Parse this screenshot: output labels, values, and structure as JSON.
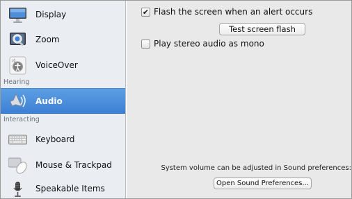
{
  "sidebar": {
    "items": [
      {
        "label": "Display",
        "icon": "display-icon"
      },
      {
        "label": "Zoom",
        "icon": "zoom-icon"
      },
      {
        "label": "VoiceOver",
        "icon": "voiceover-icon"
      },
      {
        "label": "Audio",
        "icon": "audio-icon",
        "selected": true
      },
      {
        "label": "Keyboard",
        "icon": "keyboard-icon"
      },
      {
        "label": "Mouse & Trackpad",
        "icon": "mouse-icon"
      },
      {
        "label": "Speakable Items",
        "icon": "microphone-icon"
      }
    ],
    "groups": {
      "hearing": "Hearing",
      "interacting": "Interacting"
    }
  },
  "main": {
    "flash_checkbox": {
      "label": "Flash the screen when an alert occurs",
      "checked": true
    },
    "test_flash_button": "Test screen flash",
    "mono_checkbox": {
      "label": "Play stereo audio as mono",
      "checked": false
    },
    "volume_note": "System volume can be adjusted in Sound preferences:",
    "open_sound_button": "Open Sound Preferences..."
  },
  "colors": {
    "selection": "#3d80d4",
    "sidebar_bg": "#eaeef3",
    "pane_bg": "#e9e9e9"
  }
}
